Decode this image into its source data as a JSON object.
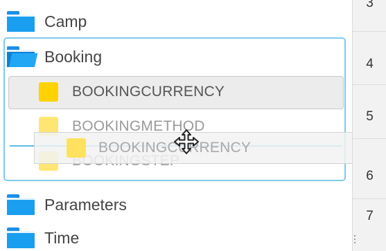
{
  "tree": {
    "folders": [
      {
        "label": "Camp",
        "icon": "folder-icon"
      },
      {
        "label": "Booking",
        "icon": "folder-open-icon"
      },
      {
        "label": "Parameters",
        "icon": "folder-icon"
      },
      {
        "label": "Time",
        "icon": "folder-icon"
      }
    ],
    "booking_fields": [
      {
        "label": "BOOKINGCURRENCY",
        "selected": true
      },
      {
        "label": "BOOKINGMETHOD",
        "selected": false
      },
      {
        "label": "BOOKINGSTEP",
        "selected": false
      }
    ],
    "drag_ghost": {
      "label": "BOOKINGCURRENCY",
      "cursor": "move-cursor-icon"
    }
  },
  "gutter": {
    "rows": [
      "3",
      "4",
      "5",
      "6",
      "7"
    ]
  },
  "colors": {
    "folder": "#1a9ff0",
    "field": "#ffd200",
    "group_border": "#7ecbee",
    "drop_line": "#5bb9e8"
  }
}
